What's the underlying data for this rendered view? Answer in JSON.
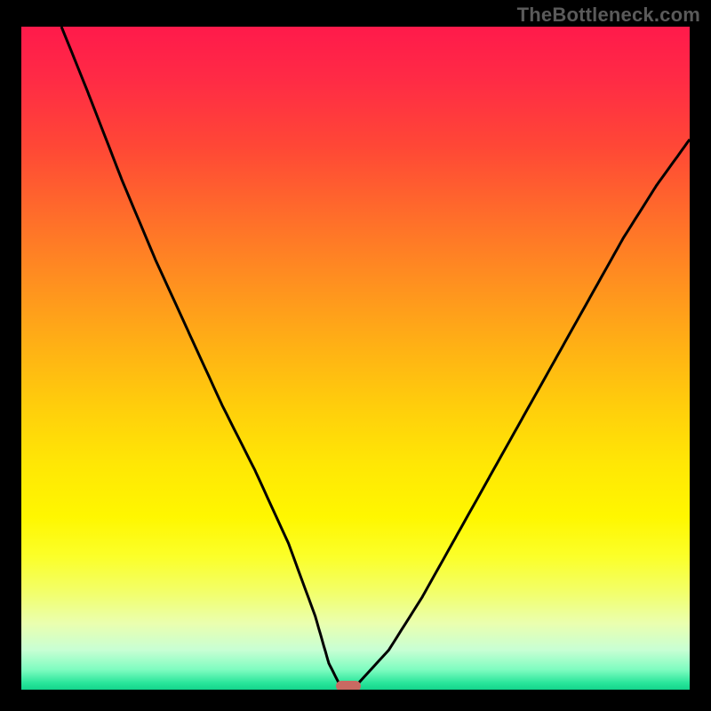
{
  "watermark": "TheBottleneck.com",
  "colors": {
    "curve": "#000000",
    "marker": "#c96a62",
    "background_black": "#000000"
  },
  "chart_data": {
    "type": "line",
    "title": "",
    "xlabel": "",
    "ylabel": "",
    "xlim": [
      0,
      100
    ],
    "ylim": [
      0,
      100
    ],
    "grid": false,
    "legend": false,
    "note": "V-shaped bottleneck curve against vertical red→yellow→green gradient. Minimum near x≈48, y≈0. Values estimated from pixel positions.",
    "series": [
      {
        "name": "bottleneck-curve",
        "x": [
          6,
          10,
          15,
          20,
          25,
          30,
          35,
          40,
          44,
          46,
          48,
          50,
          55,
          60,
          65,
          70,
          75,
          80,
          85,
          90,
          95,
          100
        ],
        "y": [
          100,
          90,
          77,
          65,
          54,
          43,
          33,
          22,
          11,
          4,
          0,
          0.5,
          6,
          14,
          23,
          32,
          41,
          50,
          59,
          68,
          76,
          83
        ]
      }
    ],
    "marker": {
      "x": 49,
      "y": 0,
      "label": ""
    },
    "gradient_stops": [
      {
        "pos": 0,
        "color": "#ff1a4b"
      },
      {
        "pos": 0.5,
        "color": "#ffd00b"
      },
      {
        "pos": 0.8,
        "color": "#fbff2a"
      },
      {
        "pos": 1.0,
        "color": "#14d48c"
      }
    ]
  }
}
